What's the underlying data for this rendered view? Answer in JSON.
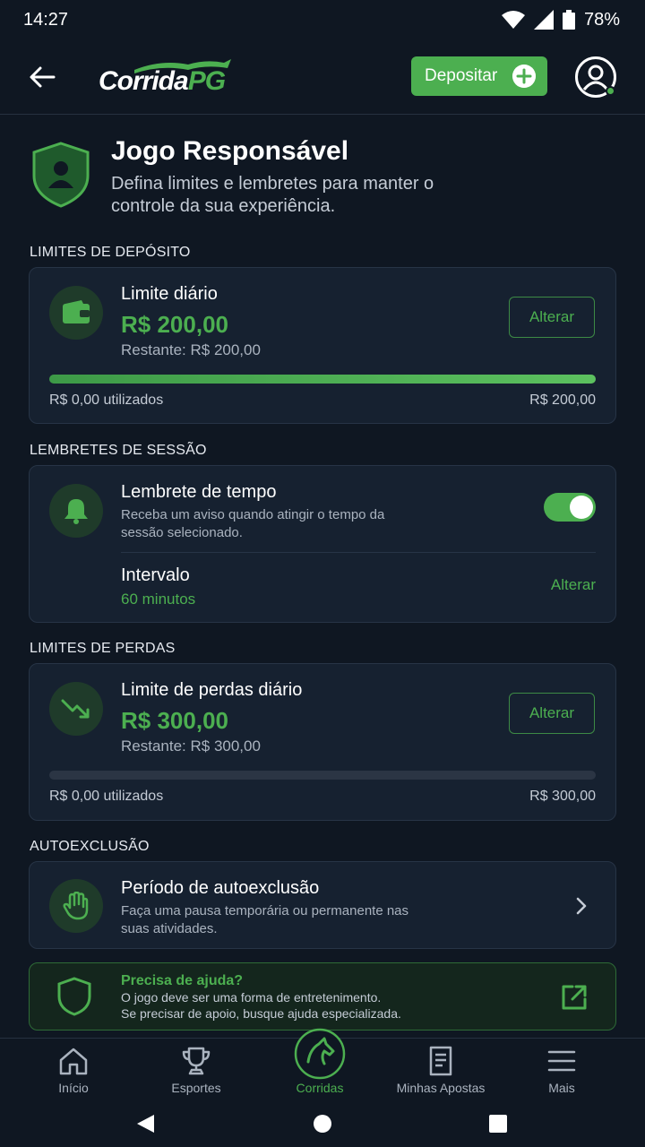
{
  "status_bar": {
    "time": "14:27",
    "battery": "78%"
  },
  "header": {
    "logo_main": "Corrida",
    "logo_accent": "PG",
    "deposit_label": "Depositar"
  },
  "hero": {
    "title": "Jogo Responsável",
    "subtitle": "Defina limites e lembretes para manter o controle da sua experiência."
  },
  "deposit_limits": {
    "section_label": "LIMITES DE DEPÓSITO",
    "title": "Limite diário",
    "amount": "R$ 200,00",
    "remaining": "Restante: R$ 200,00",
    "change_label": "Alterar",
    "used": "R$ 0,00 utilizados",
    "max": "R$ 200,00",
    "progress_fraction": 1.0
  },
  "session_reminders": {
    "section_label": "LEMBRETES DE SESSÃO",
    "title": "Lembrete de tempo",
    "description": "Receba um aviso quando atingir o tempo da sessão selecionado.",
    "toggle_on": true,
    "interval_label": "Intervalo",
    "interval_value": "60 minutos",
    "change_label": "Alterar"
  },
  "loss_limits": {
    "section_label": "LIMITES DE PERDAS",
    "title": "Limite de perdas diário",
    "amount": "R$ 300,00",
    "remaining": "Restante: R$ 300,00",
    "change_label": "Alterar",
    "used": "R$ 0,00 utilizados",
    "max": "R$ 300,00",
    "progress_fraction": 0.0
  },
  "self_exclusion": {
    "section_label": "AUTOEXCLUSÃO",
    "title": "Período de autoexclusão",
    "description": "Faça uma pausa temporária ou permanente nas suas atividades."
  },
  "help": {
    "title": "Precisa de ajuda?",
    "line1": "O jogo deve ser uma forma de entretenimento.",
    "line2": "Se precisar de apoio, busque ajuda especializada."
  },
  "bottom_nav": {
    "items": [
      {
        "label": "Início",
        "icon": "home-icon"
      },
      {
        "label": "Esportes",
        "icon": "trophy-icon"
      },
      {
        "label": "Corridas",
        "icon": "horse-icon",
        "active": true
      },
      {
        "label": "Minhas Apostas",
        "icon": "ticket-icon"
      },
      {
        "label": "Mais",
        "icon": "menu-icon"
      }
    ]
  },
  "colors": {
    "accent": "#4caf50",
    "background": "#0f1722",
    "card": "#162130"
  }
}
